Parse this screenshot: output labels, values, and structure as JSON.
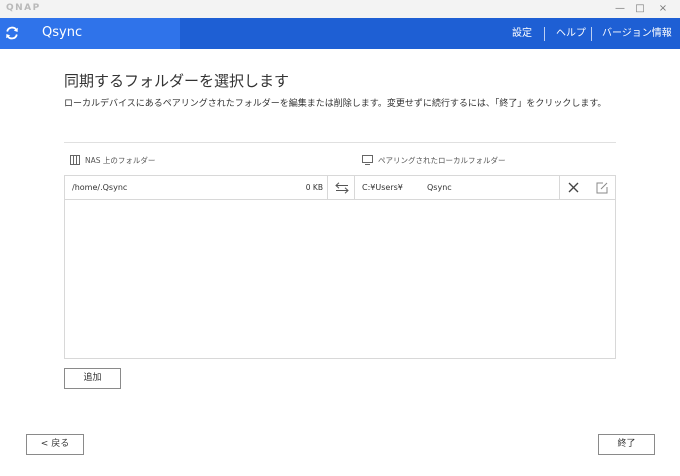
{
  "window": {
    "brand": "QNAP",
    "controls": {
      "minimize": "—",
      "maximize": "□",
      "close": "×"
    }
  },
  "appbar": {
    "app_name": "Qsync",
    "nav": {
      "settings": "設定",
      "help": "ヘルプ",
      "version": "バージョン情報"
    },
    "colors": {
      "bar": "#1e5fd4",
      "accent": "#2f73ea"
    }
  },
  "page": {
    "title": "同期するフォルダーを選択します",
    "description": "ローカルデバイスにあるペアリングされたフォルダーを編集または削除します。変更せずに続行するには、「終了」をクリックします。"
  },
  "columns": {
    "nas": "NAS 上のフォルダー",
    "local": "ペアリングされたローカルフォルダー"
  },
  "pairs": [
    {
      "nas_path": "/home/.Qsync",
      "size": "0 KB",
      "local_path": "C:¥Users¥",
      "local_folder": "Qsync"
    }
  ],
  "buttons": {
    "add": "追加",
    "back": "< 戻る",
    "finish": "終了"
  }
}
